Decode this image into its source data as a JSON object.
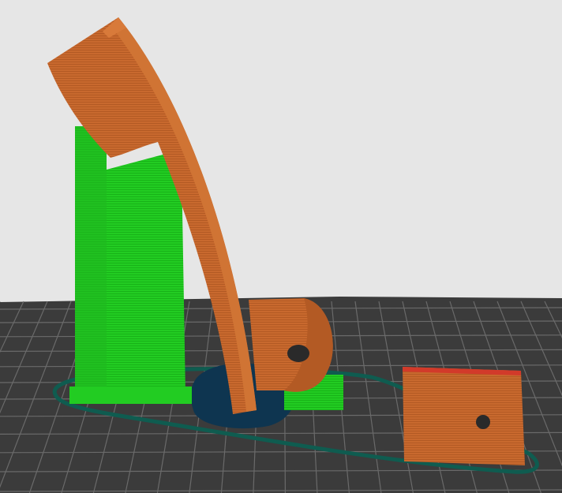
{
  "viewport": {
    "type": "3d-slicer-layer-preview",
    "colors": {
      "background": "#e6e6e6",
      "bed": "#3b3b3b",
      "bed_grid": "#6a6a6a",
      "model": "#c8692e",
      "model_shade": "#a8531f",
      "model_top": "#d23a2a",
      "support": "#22cc22",
      "support_shade": "#17a817",
      "skirt": "#0f5c50",
      "brim_pool": "#0e3550"
    },
    "objects": [
      "curved-arm",
      "hinge-block",
      "support-tower",
      "flat-plate",
      "skirt-outline"
    ]
  }
}
